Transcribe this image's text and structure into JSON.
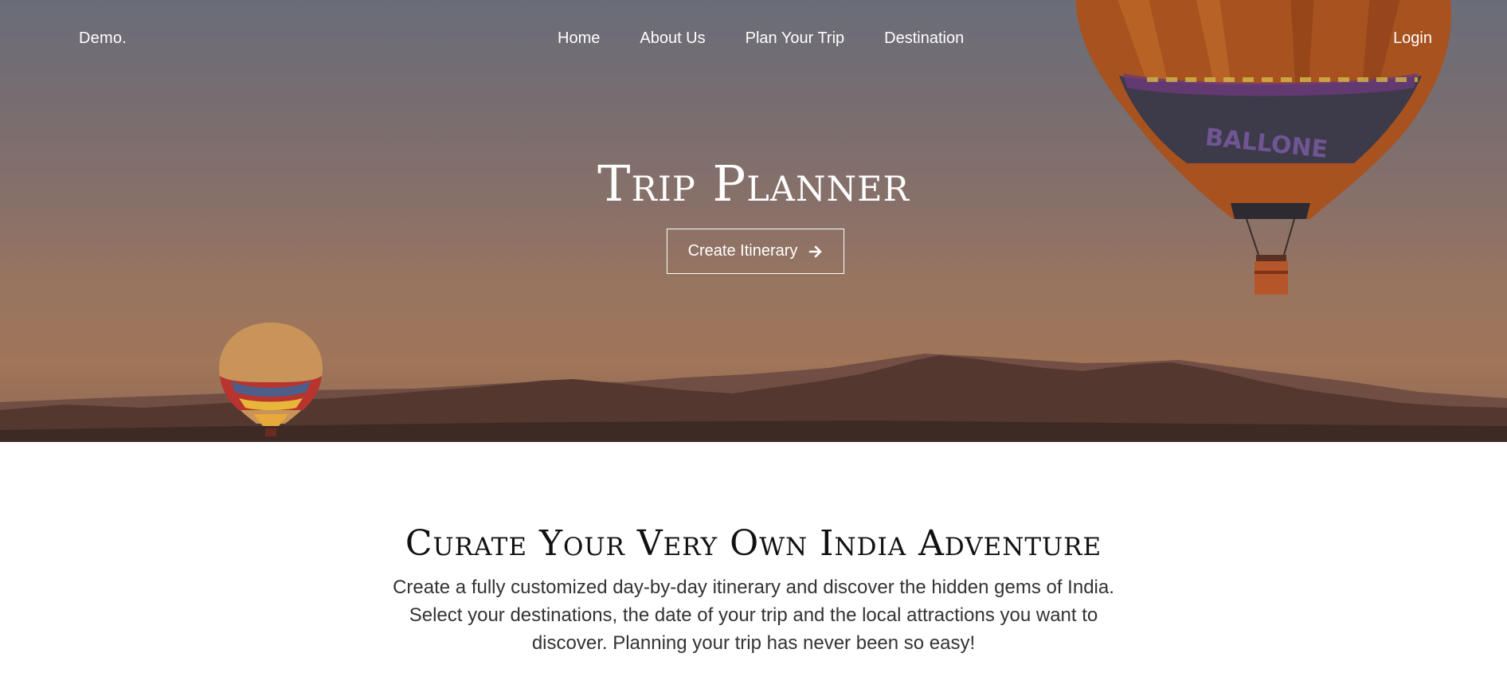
{
  "nav": {
    "brand": "Demo.",
    "links": [
      {
        "label": "Home"
      },
      {
        "label": "About Us"
      },
      {
        "label": "Plan Your Trip"
      },
      {
        "label": "Destination"
      }
    ],
    "login": "Login"
  },
  "hero": {
    "title": "Trip Planner",
    "cta_label": "Create Itinerary",
    "cta_icon": "arrow-right-icon",
    "balloon_text": "BALLONE"
  },
  "intro": {
    "title": "Curate Your Very Own India Adventure",
    "text": "Create a fully customized day-by-day itinerary and discover the hidden gems of India. Select your destinations, the date of your trip and the local attractions you want to discover. Planning your trip has never been so easy!"
  },
  "colors": {
    "hero_top": "#6a6d78",
    "hero_bottom": "#a07558",
    "mountains": "#5b3f3a",
    "text_dark": "#111111"
  }
}
